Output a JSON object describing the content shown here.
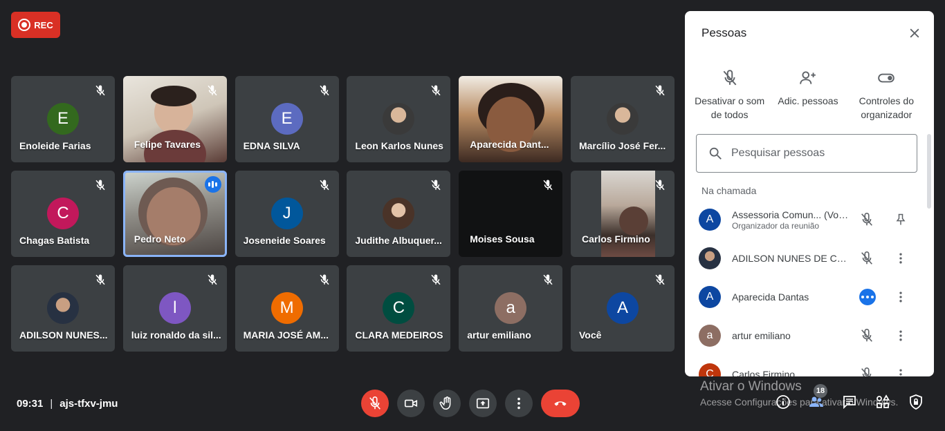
{
  "recording": {
    "label": "REC"
  },
  "tiles": [
    {
      "name": "Enoleide Farias",
      "initial": "E",
      "color": "#33691e"
    },
    {
      "name": "Felipe Tavares"
    },
    {
      "name": "EDNA SILVA",
      "initial": "E",
      "color": "#5c6bc0"
    },
    {
      "name": "Leon Karlos Nunes"
    },
    {
      "name": "Aparecida Dant..."
    },
    {
      "name": "Marcílio José Fer..."
    },
    {
      "name": "Chagas Batista",
      "initial": "C",
      "color": "#c2185b"
    },
    {
      "name": "Pedro Neto"
    },
    {
      "name": "Joseneide Soares",
      "initial": "J",
      "color": "#01579b"
    },
    {
      "name": "Judithe Albuquer..."
    },
    {
      "name": "Moises Sousa"
    },
    {
      "name": "Carlos Firmino"
    },
    {
      "name": "ADILSON NUNES..."
    },
    {
      "name": "luiz ronaldo da sil...",
      "initial": "l",
      "color": "#7e57c2"
    },
    {
      "name": "MARIA JOSÉ AM...",
      "initial": "M",
      "color": "#ef6c00"
    },
    {
      "name": "CLARA MEDEIROS",
      "initial": "C",
      "color": "#004d40"
    },
    {
      "name": "artur emiliano",
      "initial": "a",
      "color": "#8d6e63"
    },
    {
      "name": "Você",
      "initial": "A",
      "color": "#0d47a1"
    }
  ],
  "panel": {
    "title": "Pessoas",
    "actions": [
      {
        "label": "Desativar o som de todos"
      },
      {
        "label": "Adic. pessoas"
      },
      {
        "label": "Controles do organizador"
      }
    ],
    "search_placeholder": "Pesquisar pessoas",
    "section_label": "Na chamada",
    "people": [
      {
        "name": "Assessoria Comun... (Você)",
        "sub": "Organizador da reunião",
        "initial": "A",
        "color": "#0d47a1"
      },
      {
        "name": "ADILSON NUNES DE CAR..."
      },
      {
        "name": "Aparecida Dantas",
        "initial": "A",
        "color": "#0d47a1"
      },
      {
        "name": "artur emiliano",
        "initial": "a",
        "color": "#8d6e63"
      },
      {
        "name": "Carlos Firmino",
        "initial": "C",
        "color": "#bf360c"
      }
    ]
  },
  "meeting": {
    "time": "09:31",
    "separator": "|",
    "code": "ajs-tfxv-jmu"
  },
  "people_count": "18",
  "windows_watermark": {
    "title": "Ativar o Windows",
    "subtitle": "Acesse Configurações para ativar o Windows."
  }
}
